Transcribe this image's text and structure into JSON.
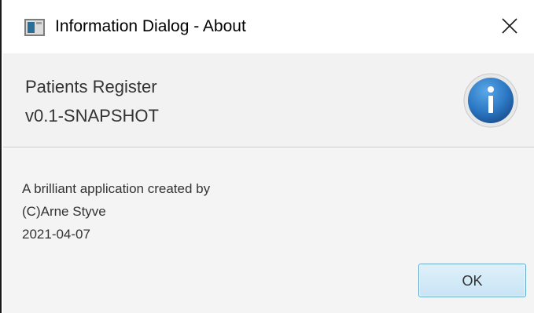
{
  "window": {
    "title": "Information Dialog - About"
  },
  "header": {
    "line1": "Patients Register",
    "line2": "v0.1-SNAPSHOT",
    "icon": "info-icon"
  },
  "content": {
    "lines": [
      "A brilliant application created by",
      "(C)Arne Styve",
      "2021-04-07"
    ]
  },
  "buttons": {
    "ok_label": "OK"
  },
  "colors": {
    "accent": "#2c78c4",
    "button_border": "#5ea3c9",
    "header_bg": "#f2f2f2"
  }
}
